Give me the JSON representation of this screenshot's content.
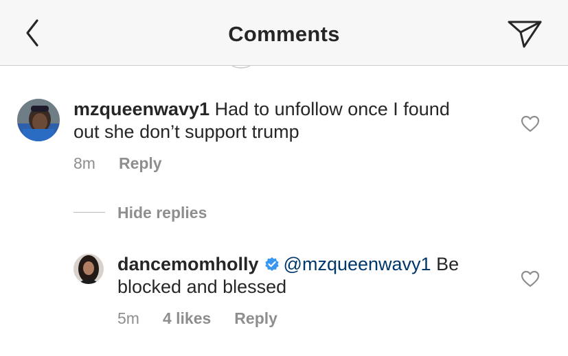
{
  "header": {
    "title": "Comments",
    "back_icon": "chevron-left-icon",
    "share_icon": "paper-plane-icon"
  },
  "comments": [
    {
      "username": "mzqueenwavy1",
      "text_line1": "Had to unfollow once I found",
      "text_line2": "out she don’t support trump",
      "time": "8m",
      "reply_label": "Reply",
      "like_icon": "heart-outline-icon"
    }
  ],
  "hide_replies_label": "Hide replies",
  "replies": [
    {
      "username": "dancemomholly",
      "verified": true,
      "mention": "@mzqueenwavy1",
      "text_line1_rest": "Be",
      "text_line2": "blocked and blessed",
      "time": "5m",
      "likes": "4 likes",
      "reply_label": "Reply",
      "like_icon": "heart-outline-icon"
    }
  ],
  "colors": {
    "header_bg": "#f7f7f7",
    "text": "#262626",
    "secondary_text": "#8e8e8e",
    "mention": "#00376b",
    "verified_badge": "#3897f0"
  }
}
